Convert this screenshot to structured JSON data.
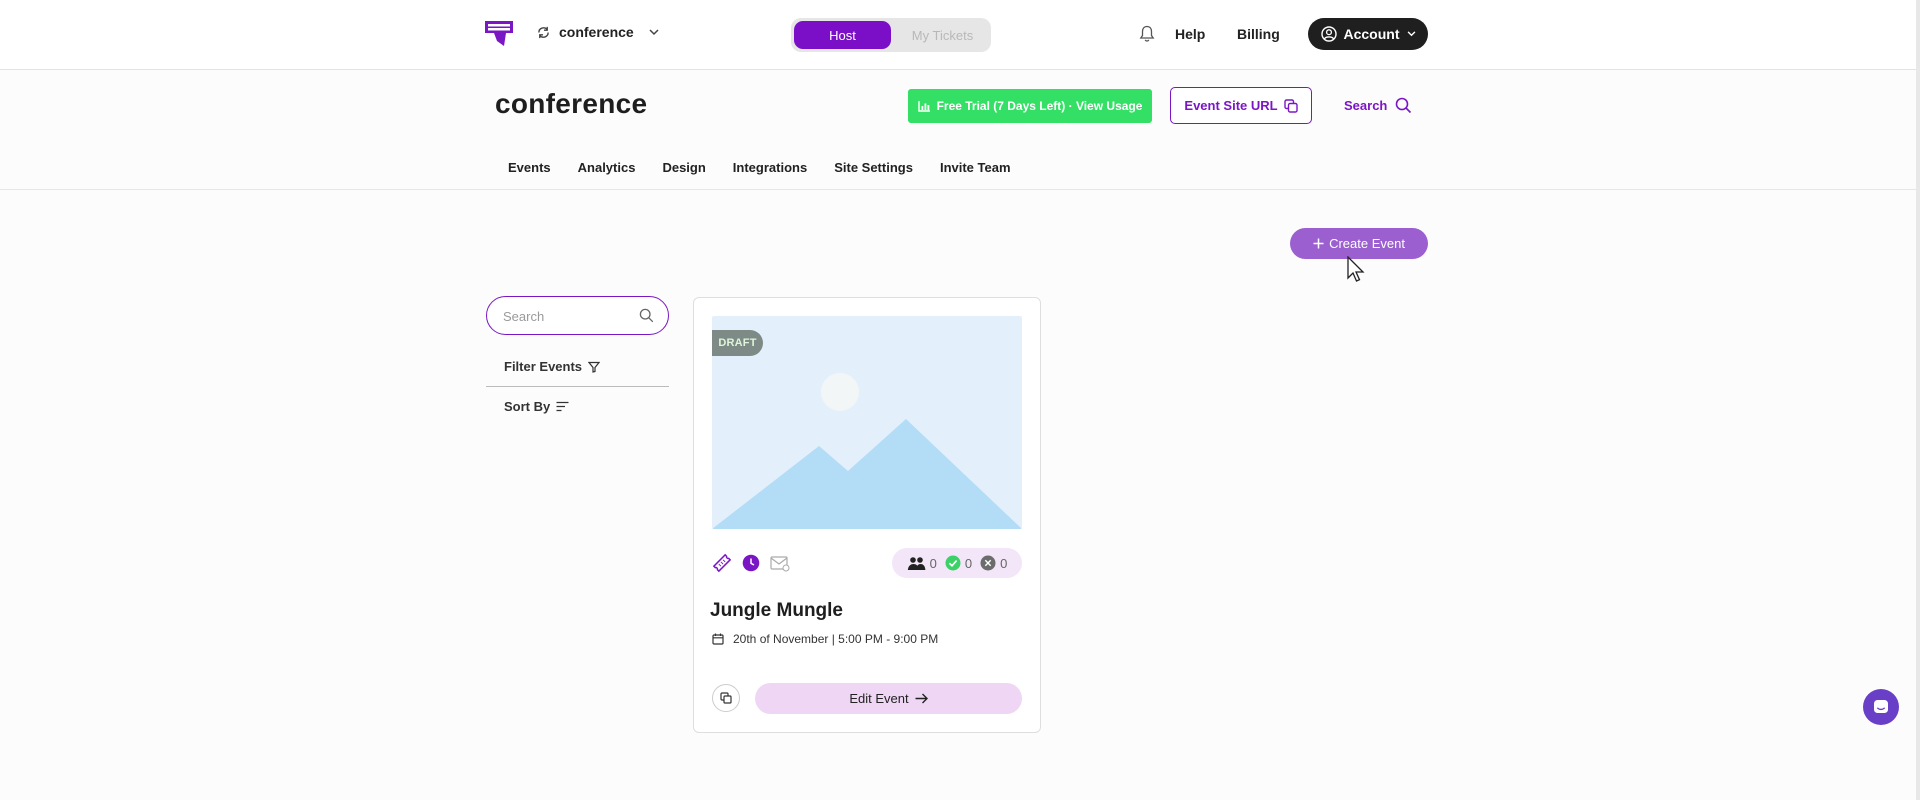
{
  "topbar": {
    "site_name": "conference",
    "mode": {
      "host_label": "Host",
      "tickets_label": "My Tickets",
      "selected": "Host"
    },
    "help_label": "Help",
    "billing_label": "Billing",
    "account_label": "Account"
  },
  "site_header": {
    "title": "conference",
    "trial_label": "Free Trial (7 Days Left) · View Usage",
    "site_url_label": "Event Site URL",
    "search_label": "Search"
  },
  "tabs": [
    {
      "label": "Events"
    },
    {
      "label": "Analytics"
    },
    {
      "label": "Design"
    },
    {
      "label": "Integrations"
    },
    {
      "label": "Site Settings"
    },
    {
      "label": "Invite Team"
    }
  ],
  "actions": {
    "create_label": "Create Event"
  },
  "sidebar": {
    "search_placeholder": "Search",
    "filter_label": "Filter Events",
    "sort_label": "Sort By"
  },
  "event": {
    "badge": "DRAFT",
    "title": "Jungle Mungle",
    "date": "20th of November | 5:00 PM - 9:00 PM",
    "counts": {
      "attendees": "0",
      "approved": "0",
      "declined": "0"
    },
    "edit_label": "Edit Event"
  },
  "colors": {
    "brand": "#7b16c4",
    "trial": "#33e065",
    "create": "#9b5fd0",
    "edit_bg": "#efd6f5"
  }
}
